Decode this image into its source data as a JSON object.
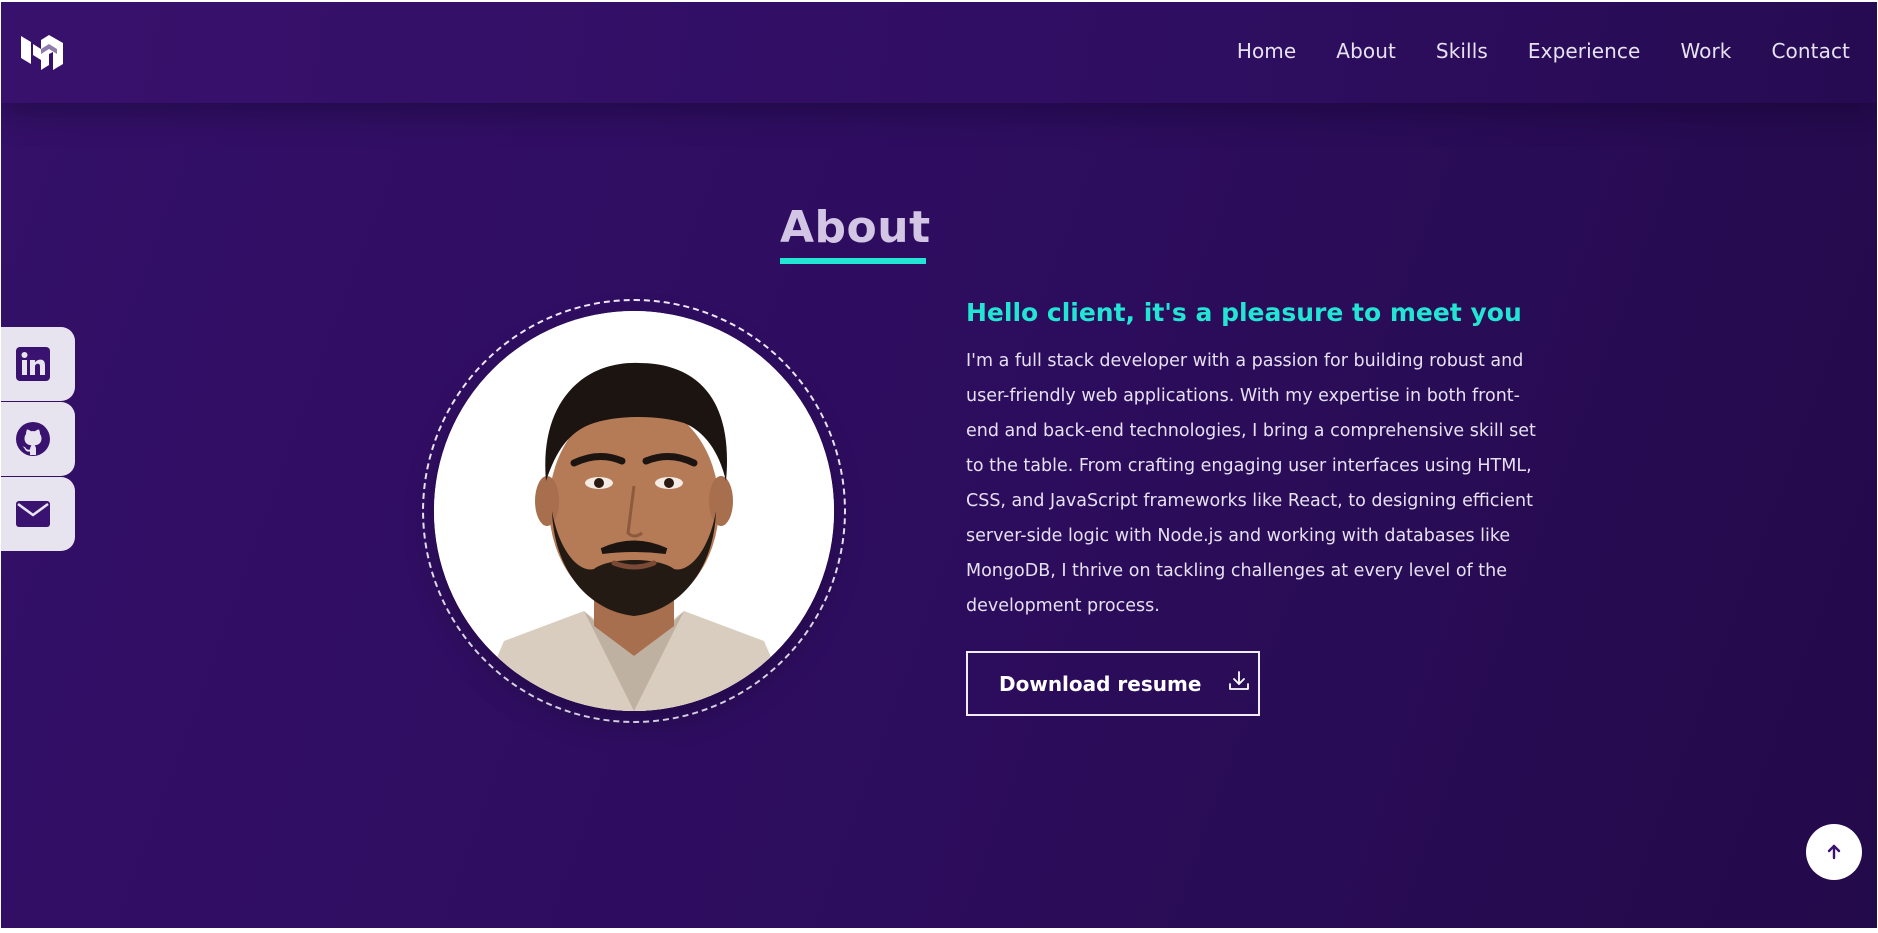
{
  "nav": {
    "logo_label": "",
    "items": [
      "Home",
      "About",
      "Skills",
      "Experience",
      "Work",
      "Contact"
    ]
  },
  "about": {
    "title": "About",
    "greeting": "Hello client, it's a pleasure to meet you",
    "bio_lines": [
      "I'm a full stack developer with a passion for building robust and",
      "user-friendly web applications. With my expertise in both front-",
      "end and back-end technologies, I bring a comprehensive skill set",
      "to the table. From crafting engaging user interfaces using HTML,",
      "CSS, and JavaScript frameworks like React, to designing efficient",
      "server-side logic with Node.js and working with databases like",
      "MongoDB, I thrive on tackling challenges at every level of the",
      "development process."
    ],
    "button_label": "Download resume"
  },
  "social": {
    "icons": [
      "linkedin-icon",
      "github-icon",
      "mail-icon"
    ]
  },
  "colors": {
    "accent": "#22e6d3",
    "background": "#2e0d60",
    "icon_dark": "#3a1270"
  }
}
